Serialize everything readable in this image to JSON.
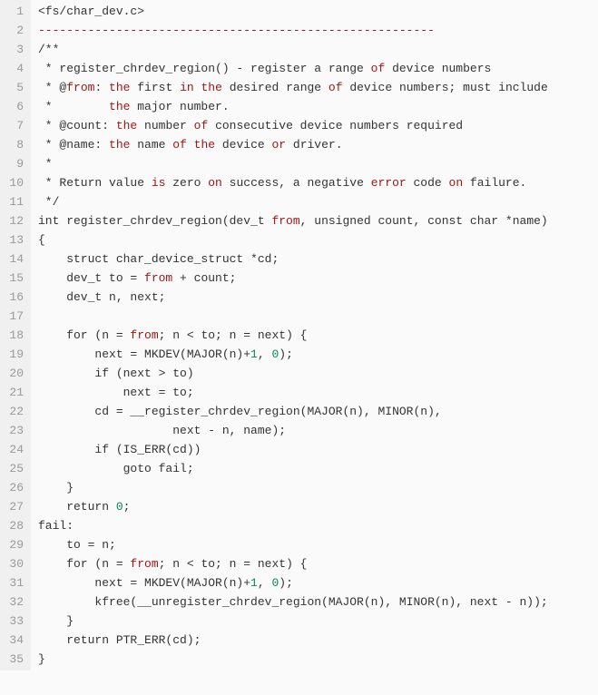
{
  "code": {
    "lines": [
      {
        "n": "1",
        "html": "&lt;fs/char_dev.c&gt;"
      },
      {
        "n": "2",
        "html": "<span class='kw'>--------------------------------------------------------</span>"
      },
      {
        "n": "3",
        "html": "/**"
      },
      {
        "n": "4",
        "html": " * register_chrdev_region() - register a range <span class='kw'>of</span> device numbers"
      },
      {
        "n": "5",
        "html": " * @<span class='kw'>from</span>: <span class='kw'>the</span> first <span class='kw'>in</span> <span class='kw'>the</span> desired range <span class='kw'>of</span> device numbers; must include"
      },
      {
        "n": "6",
        "html": " *        <span class='kw'>the</span> major number."
      },
      {
        "n": "7",
        "html": " * @count: <span class='kw'>the</span> number <span class='kw'>of</span> consecutive device numbers required"
      },
      {
        "n": "8",
        "html": " * @name: <span class='kw'>the</span> name <span class='kw'>of</span> <span class='kw'>the</span> device <span class='kw'>or</span> driver."
      },
      {
        "n": "9",
        "html": " *"
      },
      {
        "n": "10",
        "html": " * Return value <span class='kw'>is</span> zero <span class='kw'>on</span> success, a negative <span class='kw'>error</span> code <span class='kw'>on</span> failure."
      },
      {
        "n": "11",
        "html": " */"
      },
      {
        "n": "12",
        "html": "int register_chrdev_region(dev_t <span class='kw'>from</span>, unsigned count, const char *name)"
      },
      {
        "n": "13",
        "html": "{"
      },
      {
        "n": "14",
        "html": "    struct char_device_struct *cd;"
      },
      {
        "n": "15",
        "html": "    dev_t to = <span class='kw'>from</span> + count;"
      },
      {
        "n": "16",
        "html": "    dev_t n, next;"
      },
      {
        "n": "17",
        "html": ""
      },
      {
        "n": "18",
        "html": "    for (n = <span class='kw'>from</span>; n &lt; to; n = next) {"
      },
      {
        "n": "19",
        "html": "        next = MKDEV(MAJOR(n)+<span class='num'>1</span>, <span class='num'>0</span>);"
      },
      {
        "n": "20",
        "html": "        if (next &gt; to)"
      },
      {
        "n": "21",
        "html": "            next = to;"
      },
      {
        "n": "22",
        "html": "        cd = __register_chrdev_region(MAJOR(n), MINOR(n),"
      },
      {
        "n": "23",
        "html": "                   next - n, name);"
      },
      {
        "n": "24",
        "html": "        if (IS_ERR(cd))"
      },
      {
        "n": "25",
        "html": "            goto fail;"
      },
      {
        "n": "26",
        "html": "    }"
      },
      {
        "n": "27",
        "html": "    return <span class='num'>0</span>;"
      },
      {
        "n": "28",
        "html": "fail:"
      },
      {
        "n": "29",
        "html": "    to = n;"
      },
      {
        "n": "30",
        "html": "    for (n = <span class='kw'>from</span>; n &lt; to; n = next) {"
      },
      {
        "n": "31",
        "html": "        next = MKDEV(MAJOR(n)+<span class='num'>1</span>, <span class='num'>0</span>);"
      },
      {
        "n": "32",
        "html": "        kfree(__unregister_chrdev_region(MAJOR(n), MINOR(n), next - n));"
      },
      {
        "n": "33",
        "html": "    }"
      },
      {
        "n": "34",
        "html": "    return PTR_ERR(cd);"
      },
      {
        "n": "35",
        "html": "}"
      }
    ]
  }
}
